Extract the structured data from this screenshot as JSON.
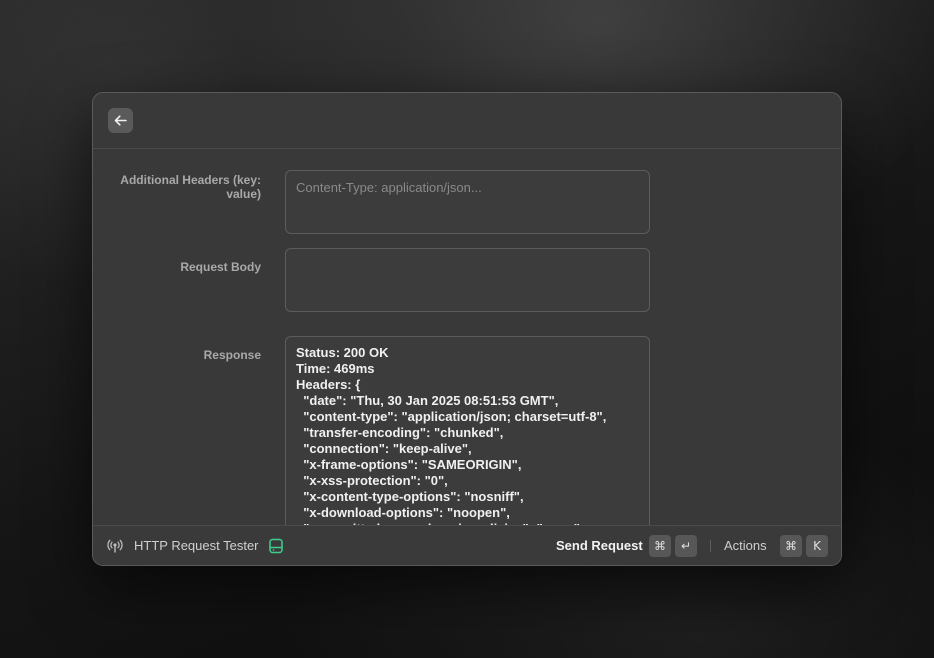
{
  "app": {
    "title": "HTTP Request Tester",
    "icon": "broadcast-icon",
    "status_icon": "drive-icon",
    "accent_color": "#3ecf8e"
  },
  "form": {
    "headers": {
      "label": "Additional Headers (key: value)",
      "placeholder": "Content-Type: application/json..."
    },
    "body": {
      "label": "Request Body",
      "value": ""
    },
    "response": {
      "label": "Response",
      "lines": [
        "Status: 200 OK",
        "Time: 469ms",
        "Headers: {",
        "  \"date\": \"Thu, 30 Jan 2025 08:51:53 GMT\",",
        "  \"content-type\": \"application/json; charset=utf-8\",",
        "  \"transfer-encoding\": \"chunked\",",
        "  \"connection\": \"keep-alive\",",
        "  \"x-frame-options\": \"SAMEORIGIN\",",
        "  \"x-xss-protection\": \"0\",",
        "  \"x-content-type-options\": \"nosniff\",",
        "  \"x-download-options\": \"noopen\",",
        "  \"x-permitted-cross-domain-policies\": \"none\","
      ]
    }
  },
  "footer": {
    "primary_action": "Send Request",
    "primary_shortcut": [
      "⌘",
      "↵"
    ],
    "actions_label": "Actions",
    "actions_shortcut": [
      "⌘",
      "K"
    ]
  }
}
